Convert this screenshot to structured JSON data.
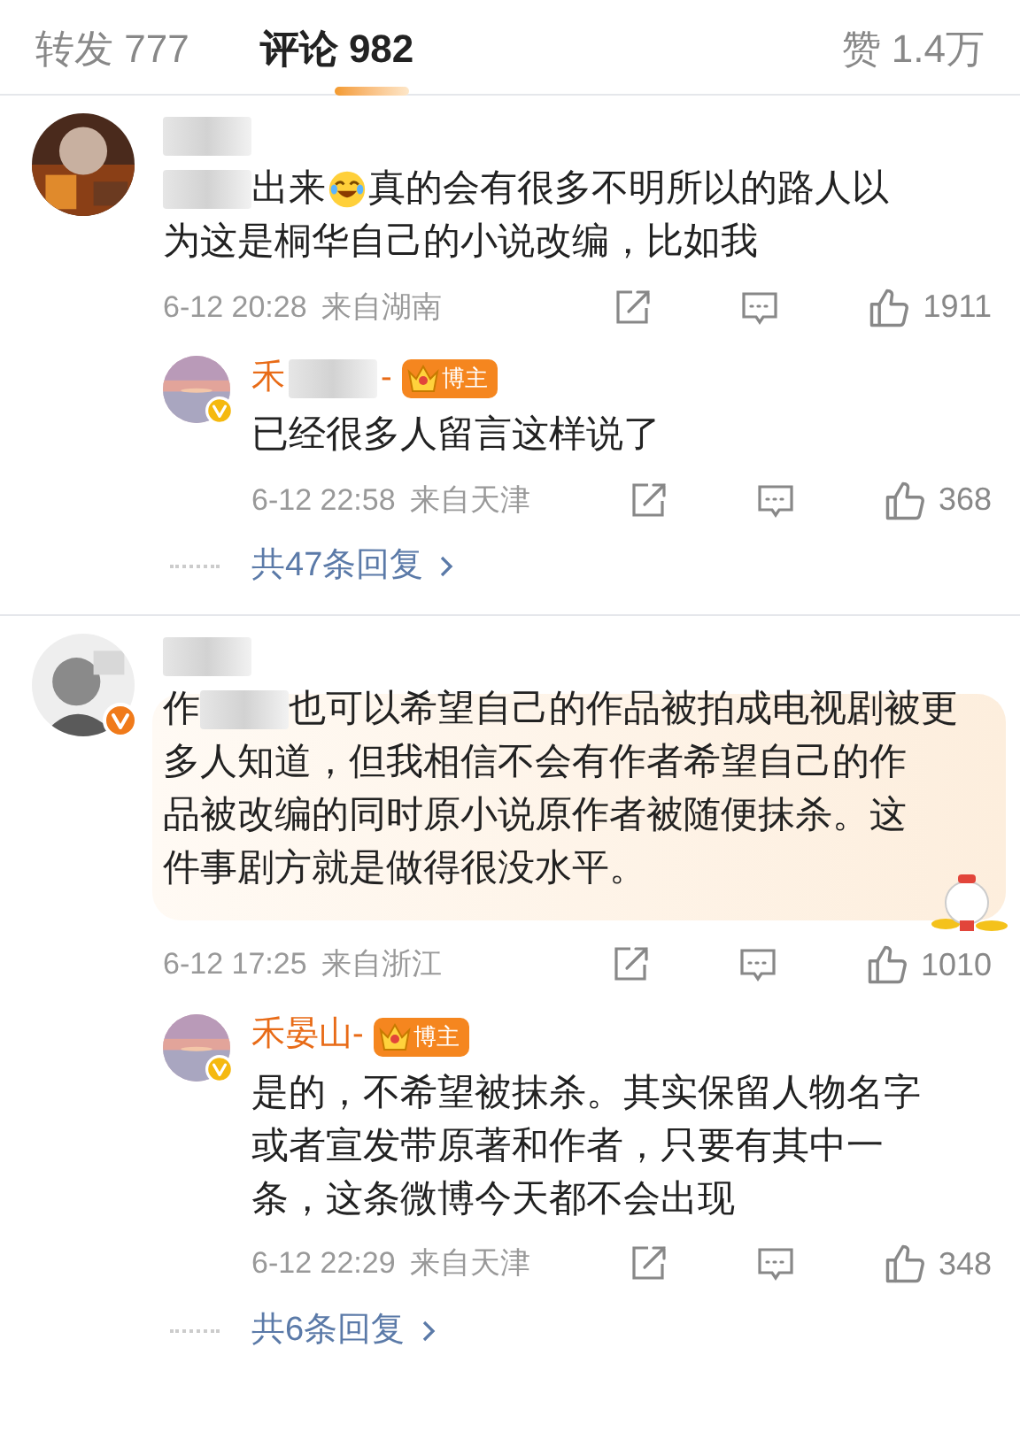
{
  "tabs": [
    {
      "label": "转发 777",
      "selected": false
    },
    {
      "label": "评论 982",
      "selected": true
    },
    {
      "label": "赞 1.4万",
      "selected": false
    }
  ],
  "comments": [
    {
      "avatar": {
        "kind": "picture"
      },
      "name": [
        {
          "kind": "redacted"
        }
      ],
      "highlighted": false,
      "lines": [
        [
          {
            "kind": "redacted"
          },
          {
            "kind": "text",
            "text": "出来"
          },
          {
            "kind": "emoji"
          },
          {
            "kind": "text",
            "text": "真的会有很多不明所以的路人以"
          }
        ],
        [
          {
            "kind": "text",
            "text": "为这是桐华自己的小说改编，比如我"
          }
        ]
      ],
      "time": "6-12 20:28",
      "location": "来自湖南",
      "likes": "1911",
      "reply": {
        "name": [
          {
            "kind": "text",
            "text": "禾"
          },
          {
            "kind": "redacted"
          },
          {
            "kind": "text",
            "text": "-"
          }
        ],
        "role": "博主",
        "verified_badge": {
          "color": "#f5b90f"
        },
        "lines": [
          [
            {
              "kind": "text",
              "text": "已经很多人留言这样说了"
            }
          ]
        ],
        "time": "6-12 22:58",
        "location": "来自天津",
        "likes": "368"
      },
      "more_replies": "共47条回复"
    },
    {
      "avatar": {
        "kind": "picture"
      },
      "verified_badge": {
        "color": "#f07a1a"
      },
      "name": [
        {
          "kind": "redacted"
        }
      ],
      "highlighted": true,
      "lines": [
        [
          {
            "kind": "text",
            "text": "作"
          },
          {
            "kind": "redacted"
          },
          {
            "kind": "text",
            "text": "也可以希望自己的作品被拍成电视剧被更"
          }
        ],
        [
          {
            "kind": "text",
            "text": "多人知道，但我相信不会有作者希望自己的作"
          }
        ],
        [
          {
            "kind": "text",
            "text": "品被改编的同时原小说原作者被随便抹杀。这"
          }
        ],
        [
          {
            "kind": "text",
            "text": "件事剧方就是做得很没水平。"
          }
        ]
      ],
      "time": "6-12 17:25",
      "location": "来自浙江",
      "likes": "1010",
      "reply": {
        "name": [
          {
            "kind": "text",
            "text": "禾晏山-"
          }
        ],
        "role": "博主",
        "verified_badge": {
          "color": "#f5b90f"
        },
        "lines": [
          [
            {
              "kind": "text",
              "text": "是的，不希望被抹杀。其实保留人物名字"
            }
          ],
          [
            {
              "kind": "text",
              "text": "或者宣发带原著和作者，只要有其中一"
            }
          ],
          [
            {
              "kind": "text",
              "text": "条，这条微博今天都不会出现"
            }
          ]
        ],
        "time": "6-12 22:29",
        "location": "来自天津",
        "likes": "348"
      },
      "more_replies": "共6条回复"
    }
  ]
}
